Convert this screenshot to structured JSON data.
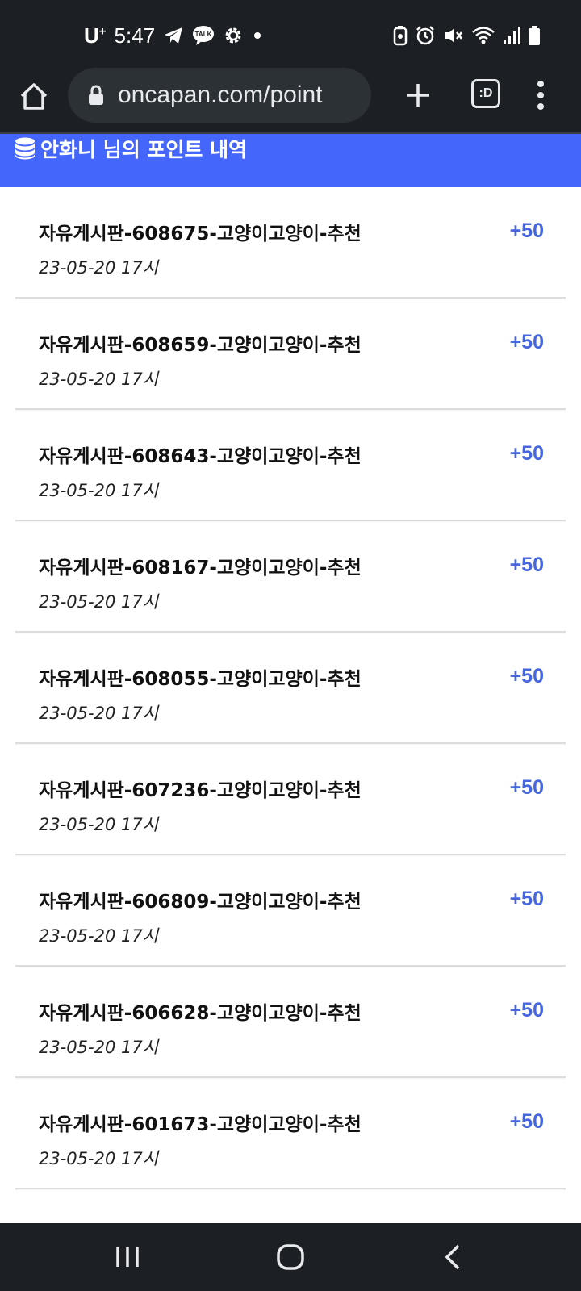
{
  "status_bar": {
    "carrier": "U",
    "carrier_sup": "+",
    "time": "5:47",
    "left_icons": [
      "telegram-icon",
      "kakaotalk-icon",
      "settings-icon",
      "dot-icon"
    ],
    "right_icons": [
      "battery-saver-icon",
      "alarm-icon",
      "mute-icon",
      "wifi-icon",
      "signal-icon",
      "battery-icon"
    ],
    "talk_label": "TALK"
  },
  "browser": {
    "url": "oncapan.com/point",
    "tabs_label": ":D"
  },
  "page": {
    "header_title": "안화니 님의 포인트 내역",
    "accent_color": "#4566fa",
    "points_color": "#4566dd",
    "items": [
      {
        "title": "자유게시판-608675-고양이고양이-추천",
        "date": "23-05-20 17시",
        "points": "+50"
      },
      {
        "title": "자유게시판-608659-고양이고양이-추천",
        "date": "23-05-20 17시",
        "points": "+50"
      },
      {
        "title": "자유게시판-608643-고양이고양이-추천",
        "date": "23-05-20 17시",
        "points": "+50"
      },
      {
        "title": "자유게시판-608167-고양이고양이-추천",
        "date": "23-05-20 17시",
        "points": "+50"
      },
      {
        "title": "자유게시판-608055-고양이고양이-추천",
        "date": "23-05-20 17시",
        "points": "+50"
      },
      {
        "title": "자유게시판-607236-고양이고양이-추천",
        "date": "23-05-20 17시",
        "points": "+50"
      },
      {
        "title": "자유게시판-606809-고양이고양이-추천",
        "date": "23-05-20 17시",
        "points": "+50"
      },
      {
        "title": "자유게시판-606628-고양이고양이-추천",
        "date": "23-05-20 17시",
        "points": "+50"
      },
      {
        "title": "자유게시판-601673-고양이고양이-추천",
        "date": "23-05-20 17시",
        "points": "+50"
      }
    ]
  },
  "nav_bar": {
    "buttons": [
      "recent-apps-icon",
      "home-icon",
      "back-icon"
    ]
  }
}
